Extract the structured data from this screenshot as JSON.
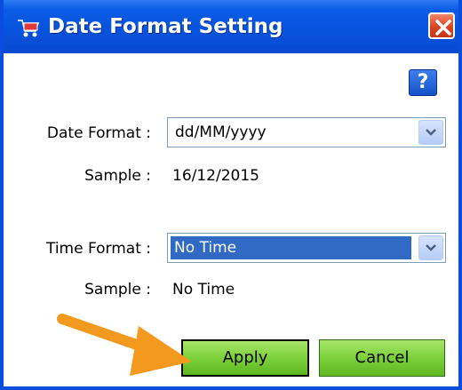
{
  "window": {
    "title": "Date Format Setting",
    "help_label": "?"
  },
  "date_format": {
    "label": "Date Format :",
    "value": "dd/MM/yyyy",
    "sample_label": "Sample :",
    "sample_value": "16/12/2015"
  },
  "time_format": {
    "label": "Time Format :",
    "value": "No Time",
    "sample_label": "Sample :",
    "sample_value": "No Time"
  },
  "buttons": {
    "apply": "Apply",
    "cancel": "Cancel"
  },
  "colors": {
    "titlebar": "#0752dc",
    "button_green": "#7bd13a",
    "selection": "#316ac5",
    "annotation_arrow": "#f39a1e"
  },
  "icons": {
    "title": "cart-icon",
    "close": "close-icon",
    "help": "help-icon",
    "dropdown": "chevron-down-icon",
    "annotation": "arrow-annotation"
  }
}
